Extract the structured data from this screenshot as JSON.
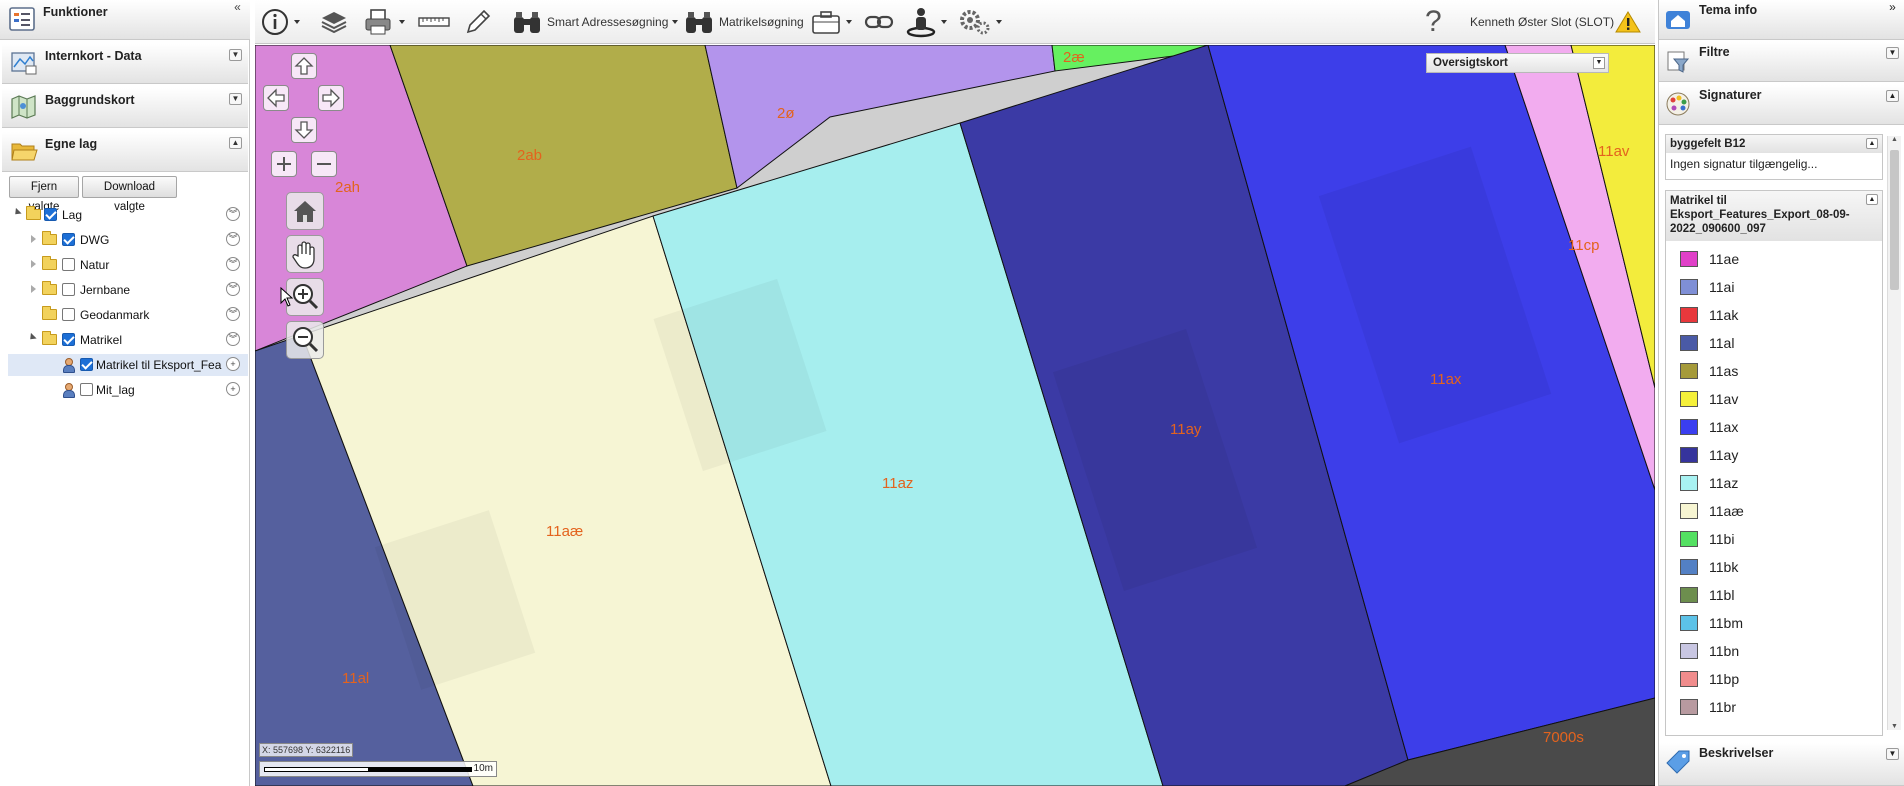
{
  "left_panel": {
    "sections": {
      "funktioner": "Funktioner",
      "internkort": "Internkort - Data",
      "baggrundskort": "Baggrundskort",
      "egne_lag": "Egne lag"
    },
    "buttons": {
      "fjern": "Fjern valgte",
      "download": "Download valgte"
    },
    "tree": {
      "lag": "Lag",
      "dwg": "DWG",
      "natur": "Natur",
      "jernbane": "Jernbane",
      "geodanmark": "Geodanmark",
      "matrikel": "Matrikel",
      "matrikel_export": "Matrikel til Eksport_Fea",
      "mit_lag": "Mit_lag"
    }
  },
  "toolbar": {
    "smart_search": "Smart Adressesøgning",
    "matrikel_search": "Matrikelsøgning",
    "user": "Kenneth Øster Slot (SLOT)",
    "help": "?"
  },
  "map": {
    "overview": "Oversigtskort",
    "coords": "X: 557698 Y: 6322116",
    "scale": "10m",
    "labels": {
      "l2ah": "2ah",
      "l2ab": "2ab",
      "l2o": "2ø",
      "l2ae": "2æ",
      "l11av": "11av",
      "l11cp": "11cp",
      "l11ax": "11ax",
      "l11ay": "11ay",
      "l11az": "11az",
      "l11aae": "11aæ",
      "l11al": "11al",
      "l7000s": "7000s"
    }
  },
  "right_panel": {
    "sections": {
      "tema": "Tema info",
      "filtre": "Filtre",
      "signaturer": "Signaturer",
      "beskrivelser": "Beskrivelser"
    },
    "byggefelt": {
      "title": "byggefelt B12",
      "text": "Ingen signatur tilgængelig..."
    },
    "matrikel_title": "Matrikel til Eksport_Features_Export_08-09-2022_090600_097",
    "legend": [
      {
        "label": "11ae",
        "color": "#e040c8"
      },
      {
        "label": "11ai",
        "color": "#7f8fd6"
      },
      {
        "label": "11ak",
        "color": "#e8383c"
      },
      {
        "label": "11al",
        "color": "#4a5aa6"
      },
      {
        "label": "11as",
        "color": "#a59a3a"
      },
      {
        "label": "11av",
        "color": "#f5f03a"
      },
      {
        "label": "11ax",
        "color": "#3a3ef0"
      },
      {
        "label": "11ay",
        "color": "#36349c"
      },
      {
        "label": "11az",
        "color": "#a8f2f2"
      },
      {
        "label": "11aæ",
        "color": "#f7f5d2"
      },
      {
        "label": "11bi",
        "color": "#54e062"
      },
      {
        "label": "11bk",
        "color": "#5380c4"
      },
      {
        "label": "11bl",
        "color": "#6d8e4e"
      },
      {
        "label": "11bm",
        "color": "#5cc2e8"
      },
      {
        "label": "11bn",
        "color": "#c8c6e2"
      },
      {
        "label": "11bp",
        "color": "#f08c8c"
      },
      {
        "label": "11br",
        "color": "#b89aa0"
      }
    ]
  }
}
